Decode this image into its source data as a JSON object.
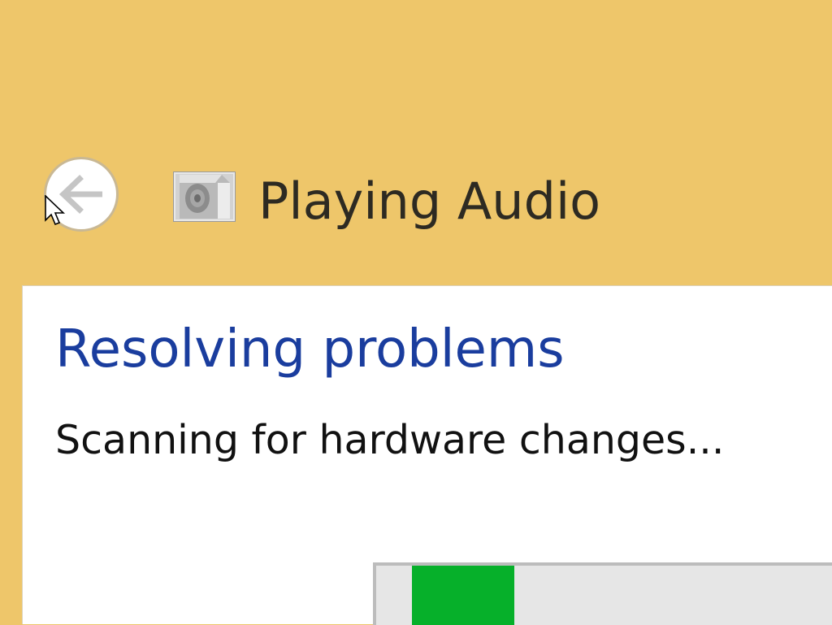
{
  "window": {
    "title": "Playing Audio",
    "back_icon": "back-arrow-icon",
    "app_icon": "speaker-icon"
  },
  "content": {
    "heading": "Resolving problems",
    "status": "Scanning for hardware changes..."
  },
  "progress": {
    "mode": "indeterminate",
    "fill_color": "#06b02a"
  },
  "colors": {
    "frame": "#eec66a",
    "heading": "#1a3d9e",
    "panel": "#ffffff"
  }
}
